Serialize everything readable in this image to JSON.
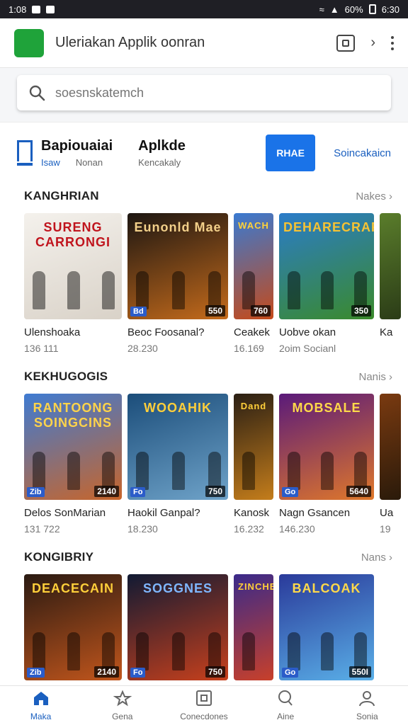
{
  "status_bar": {
    "time": "1:08",
    "right": "60%",
    "clock": "6:30"
  },
  "app_bar": {
    "title": "Uleriakan Applik oonran"
  },
  "search": {
    "placeholder": "soesnskatemch"
  },
  "tabs": {
    "primary": {
      "title": "Bapiouaiai",
      "sub_a": "Isaw",
      "sub_b": "Nonan"
    },
    "secondary": {
      "title": "Aplkde",
      "sub": "Kencakaly"
    },
    "button_label": "RHAE",
    "link_label": "Soincakaicn"
  },
  "sections": [
    {
      "title": "KANGHRIAN",
      "more": "Nakes",
      "cards": [
        {
          "name": "Ulenshoaka",
          "sub": "136 111",
          "art": "SURENG CARRONGI",
          "badge_l": "",
          "badge_r": "",
          "c1": "#f4f1ec",
          "c2": "#d9d2c8",
          "ink": "#c0141d"
        },
        {
          "name": "Beoc Foosanal?",
          "sub": "28.230",
          "art": "Eunonld Mae",
          "badge_l": "Bd",
          "badge_r": "550",
          "c1": "#1c1612",
          "c2": "#c56b1b",
          "ink": "#f2d08a"
        },
        {
          "name": "Ceakek",
          "sub": "16.169",
          "art": "WACH",
          "badge_l": "",
          "badge_r": "760",
          "c1": "#3a7ad1",
          "c2": "#c54a1a",
          "ink": "#ffd23a"
        },
        {
          "name": "Uobve okan",
          "sub": "2oim Socianl",
          "art": "DEHARECRAR",
          "badge_l": "",
          "badge_r": "350",
          "c1": "#2b7cc9",
          "c2": "#3a8a2b",
          "ink": "#f6c233"
        },
        {
          "name": "Ka",
          "sub": "",
          "art": "",
          "badge_l": "",
          "badge_r": "",
          "c1": "#5a7d2b",
          "c2": "#2b3c17",
          "ink": "#fff"
        }
      ]
    },
    {
      "title": "KEKHUGOGIS",
      "more": "Nanis",
      "cards": [
        {
          "name": "Delos SonMarian",
          "sub": "131 722",
          "art": "RANTOONG SOINGCINS",
          "badge_l": "Zib",
          "badge_r": "2140",
          "c1": "#3f7bd2",
          "c2": "#c8652a",
          "ink": "#ffd44a"
        },
        {
          "name": "Haokil Ganpal?",
          "sub": "18.230",
          "art": "WOOAHIK",
          "badge_l": "Fo",
          "badge_r": "750",
          "c1": "#1b4d7a",
          "c2": "#6fa3c9",
          "ink": "#ffcf3a"
        },
        {
          "name": "Kanosk",
          "sub": "16.232",
          "art": "Dand",
          "badge_l": "",
          "badge_r": "",
          "c1": "#2a1f14",
          "c2": "#c47d1b",
          "ink": "#ffcf3a"
        },
        {
          "name": "Nagn Gsancen",
          "sub": "146.230",
          "art": "MOBSALE",
          "badge_l": "Go",
          "badge_r": "5640",
          "c1": "#5a1a7a",
          "c2": "#e0782a",
          "ink": "#ffd94a"
        },
        {
          "name": "Ua",
          "sub": "19",
          "art": "",
          "badge_l": "",
          "badge_r": "",
          "c1": "#7a3a10",
          "c2": "#2a1a0a",
          "ink": "#fff"
        }
      ]
    },
    {
      "title": "KONGIBRIY",
      "more": "Nans",
      "cards": [
        {
          "name": "",
          "sub": "",
          "art": "DEACECAIN",
          "badge_l": "Zib",
          "badge_r": "2140",
          "c1": "#2a1a12",
          "c2": "#c2561c",
          "ink": "#ffcf3a"
        },
        {
          "name": "",
          "sub": "",
          "art": "SOGGNES",
          "badge_l": "Fo",
          "badge_r": "750",
          "c1": "#111a33",
          "c2": "#c8401c",
          "ink": "#7fb7ff"
        },
        {
          "name": "",
          "sub": "",
          "art": "ZINCHE",
          "badge_l": "",
          "badge_r": "",
          "c1": "#3a2a8a",
          "c2": "#c8402a",
          "ink": "#ffcf3a"
        },
        {
          "name": "",
          "sub": "",
          "art": "BALCOAK",
          "badge_l": "Go",
          "badge_r": "550I",
          "c1": "#2a3a9a",
          "c2": "#5ab0e8",
          "ink": "#ffd94a"
        }
      ]
    }
  ],
  "bottom_nav": [
    {
      "label": "Maka",
      "icon": "home-icon",
      "active": true
    },
    {
      "label": "Gena",
      "icon": "games-icon",
      "active": false
    },
    {
      "label": "Conecdones",
      "icon": "apps-icon",
      "active": false
    },
    {
      "label": "Aine",
      "icon": "search-icon",
      "active": false
    },
    {
      "label": "Sonia",
      "icon": "account-icon",
      "active": false
    }
  ],
  "colors": {
    "accent": "#1a73e8",
    "link": "#1a5fbf",
    "logo": "#1fa33a"
  }
}
